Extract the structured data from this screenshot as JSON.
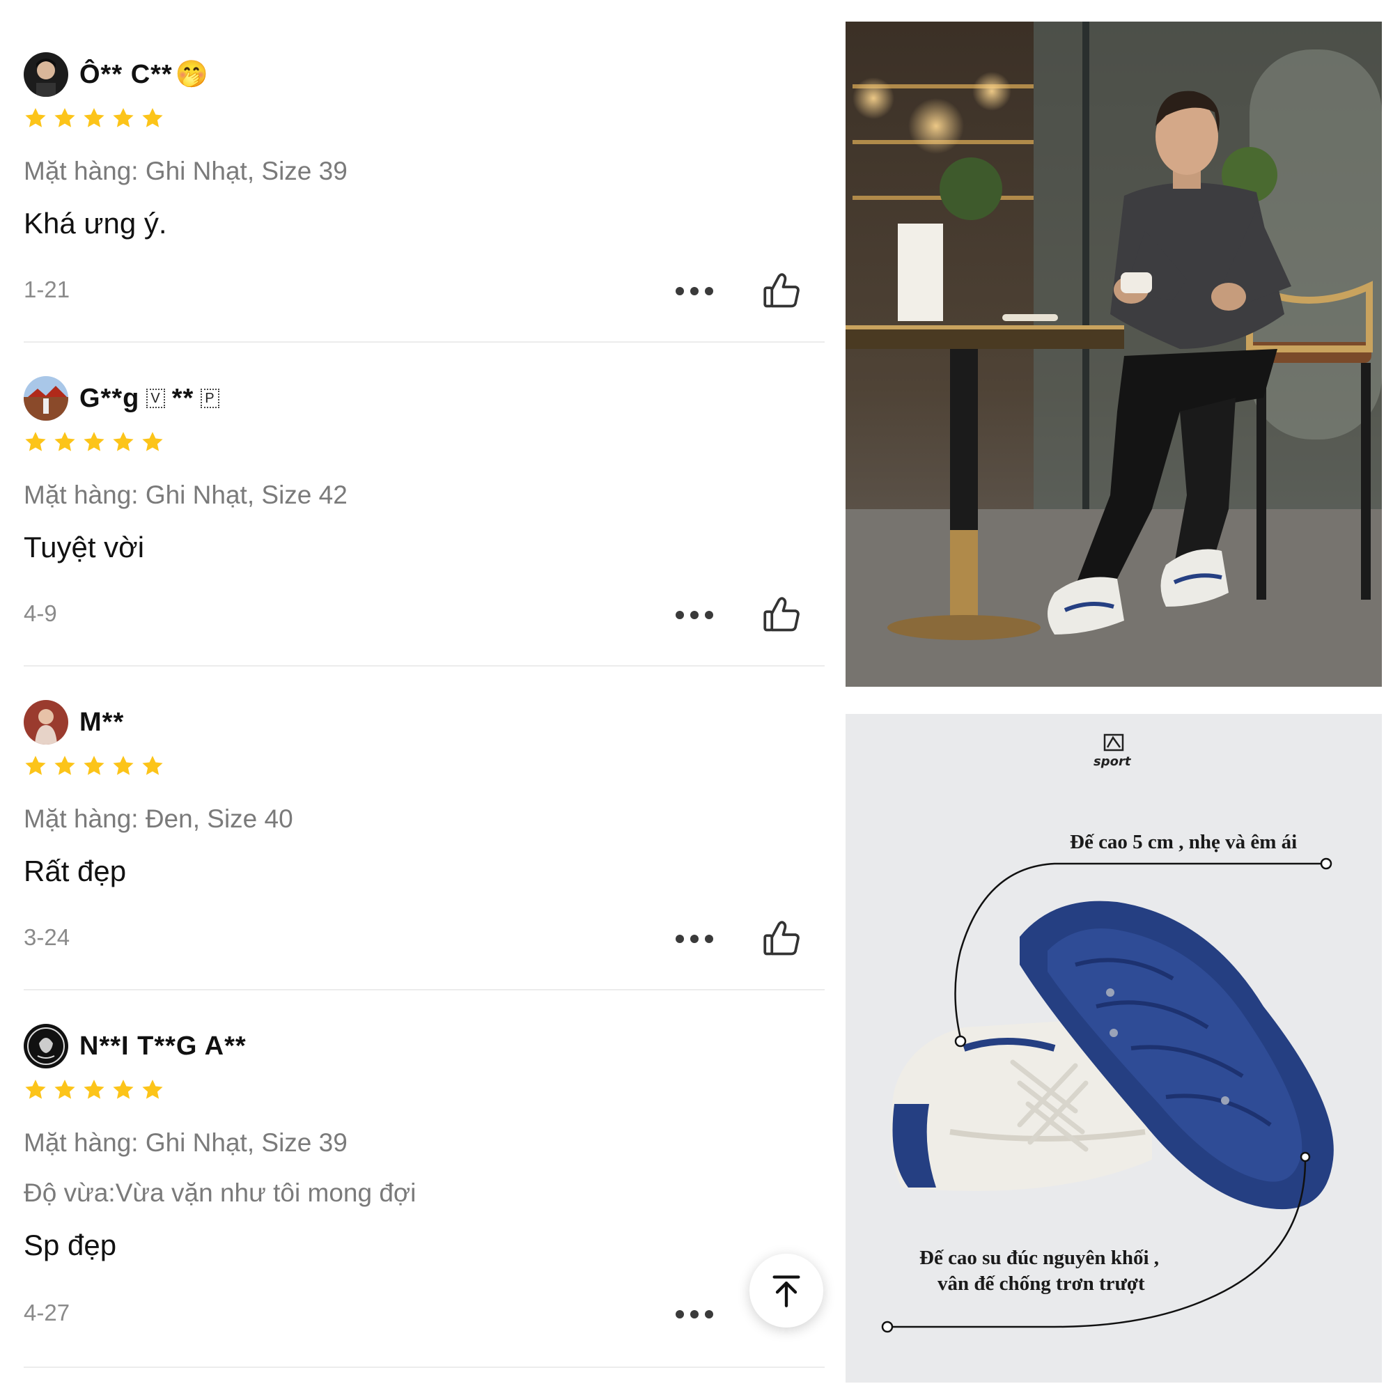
{
  "reviews": [
    {
      "username": "Ô** C**",
      "emoji": "🤭",
      "rating": 5,
      "variant": "Mặt hàng: Ghi Nhạt, Size 39",
      "comment": "Khá ưng ý.",
      "date": "1-21"
    },
    {
      "username": "G**g",
      "badge1": "V",
      "username_part2": "**",
      "badge2": "P",
      "rating": 5,
      "variant": "Mặt hàng: Ghi Nhạt, Size 42",
      "comment": "Tuyệt vời",
      "date": "4-9"
    },
    {
      "username": "M**",
      "rating": 5,
      "variant": "Mặt hàng: Đen, Size 40",
      "comment": "Rất đẹp",
      "date": "3-24"
    },
    {
      "username": "N**I T**G A**",
      "rating": 5,
      "variant": "Mặt hàng: Ghi Nhạt, Size 39",
      "fit": "Độ vừa:Vừa vặn như tôi mong đợi",
      "comment": "Sp đẹp",
      "date": "4-27"
    }
  ],
  "icons": {
    "star": "star-icon",
    "more": "more-icon",
    "like": "thumbs-up-icon",
    "scroll_top": "arrow-up-to-top-icon"
  },
  "colors": {
    "star": "#fcc419",
    "shoe_navy": "#253f82",
    "shoe_cream": "#efede7"
  },
  "product_detail": {
    "brand": "sport",
    "caption_top": "Đế cao 5 cm , nhẹ và êm ái",
    "caption_bottom_line1": "Đế cao su đúc nguyên khối ,",
    "caption_bottom_line2": "vân đế chống trơn trượt"
  }
}
